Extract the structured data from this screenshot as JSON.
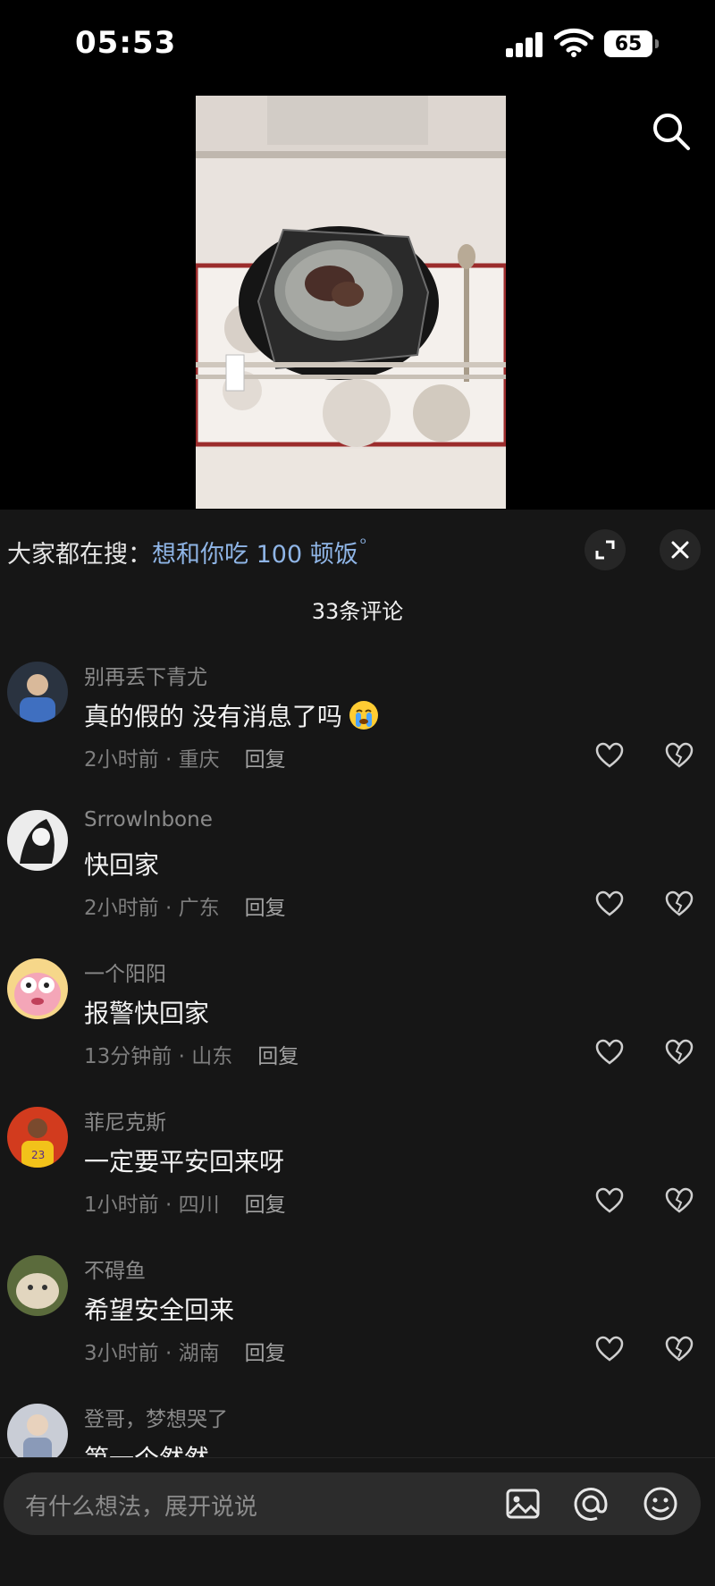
{
  "status_bar": {
    "time": "05:53",
    "battery": "65"
  },
  "hot_search": {
    "label": "大家都在搜：",
    "term": "想和你吃 100 顿饭"
  },
  "comment_count": "33条评论",
  "comments": [
    {
      "username": "别再丢下青尤",
      "text": "真的假的  没有消息了吗",
      "time": "2小时前",
      "location": "重庆",
      "reply": "回复"
    },
    {
      "username": "Srrowlnbone",
      "text": "快回家",
      "time": "2小时前",
      "location": "广东",
      "reply": "回复"
    },
    {
      "username": "一个阳阳",
      "text": "报警快回家",
      "time": "13分钟前",
      "location": "山东",
      "reply": "回复"
    },
    {
      "username": "菲尼克斯",
      "text": "一定要平安回来呀",
      "time": "1小时前",
      "location": "四川",
      "reply": "回复"
    },
    {
      "username": "不碍鱼",
      "text": "希望安全回来",
      "time": "3小时前",
      "location": "湖南",
      "reply": "回复"
    },
    {
      "username": "登哥，梦想哭了",
      "text": "第一个然然"
    }
  ],
  "input": {
    "placeholder": "有什么想法，展开说说"
  },
  "icons": [
    "search-icon",
    "expand-icon",
    "close-icon",
    "heart-icon",
    "broken-heart-icon",
    "crying-emoji-icon",
    "image-icon",
    "at-icon",
    "emoji-icon"
  ]
}
